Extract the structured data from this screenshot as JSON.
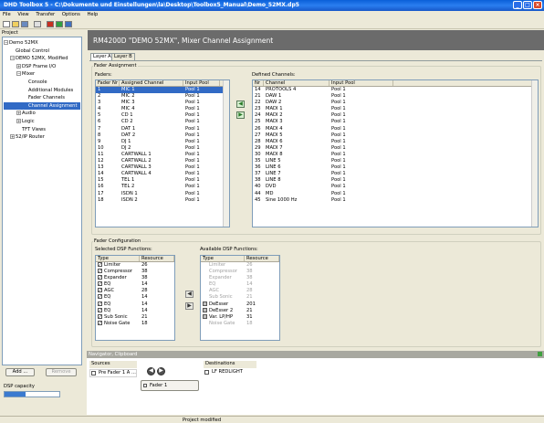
{
  "window": {
    "title": "DHD Toolbox 5 - C:\\Dokumente und Einstellungen\\la\\Desktop\\Toolbox5_Manual\\Demo_52MX.dp5"
  },
  "menu": [
    "File",
    "View",
    "Transfer",
    "Options",
    "Help"
  ],
  "project": {
    "label": "Project",
    "tree": [
      {
        "label": "Demo 52MX",
        "level": 0,
        "exp": "−"
      },
      {
        "label": "Global Control",
        "level": 1,
        "exp": ""
      },
      {
        "label": "DEMO 52MX, Modified",
        "level": 1,
        "exp": "−"
      },
      {
        "label": "DSP Frame I/O",
        "level": 2,
        "exp": "+"
      },
      {
        "label": "Mixer",
        "level": 2,
        "exp": "−"
      },
      {
        "label": "Console",
        "level": 3,
        "exp": ""
      },
      {
        "label": "Additional Modules",
        "level": 3,
        "exp": ""
      },
      {
        "label": "Fader Channels",
        "level": 3,
        "exp": ""
      },
      {
        "label": "Channel Assignment",
        "level": 3,
        "exp": "",
        "selected": true
      },
      {
        "label": "Audio",
        "level": 2,
        "exp": "+"
      },
      {
        "label": "Logic",
        "level": 2,
        "exp": "+"
      },
      {
        "label": "TFT Views",
        "level": 2,
        "exp": ""
      },
      {
        "label": "52/IP Router",
        "level": 1,
        "exp": "+"
      }
    ],
    "add_label": "Add ...",
    "remove_label": "Remove",
    "dsp_capacity_label": "DSP capacity",
    "dsp_capacity_percent": 38
  },
  "header": {
    "title": "RM4200D \"DEMO 52MX\", Mixer Channel Assignment"
  },
  "tabs": [
    "Layer A",
    "Layer B"
  ],
  "fader_assignment": {
    "label": "Fader Assignment",
    "faders_label": "Faders:",
    "defined_label": "Defined Channels:",
    "fader_headers": [
      "Fader Nr",
      "Assigned Channel",
      "Input Pool"
    ],
    "faders": [
      [
        "1",
        "MIC 1",
        "Pool 1"
      ],
      [
        "2",
        "MIC 2",
        "Pool 1"
      ],
      [
        "3",
        "MIC 3",
        "Pool 1"
      ],
      [
        "4",
        "MIC 4",
        "Pool 1"
      ],
      [
        "5",
        "CD 1",
        "Pool 1"
      ],
      [
        "6",
        "CD 2",
        "Pool 1"
      ],
      [
        "7",
        "DAT 1",
        "Pool 1"
      ],
      [
        "8",
        "DAT 2",
        "Pool 1"
      ],
      [
        "9",
        "DJ 1",
        "Pool 1"
      ],
      [
        "10",
        "DJ 2",
        "Pool 1"
      ],
      [
        "11",
        "CARTWALL 1",
        "Pool 1"
      ],
      [
        "12",
        "CARTWALL 2",
        "Pool 1"
      ],
      [
        "13",
        "CARTWALL 3",
        "Pool 1"
      ],
      [
        "14",
        "CARTWALL 4",
        "Pool 1"
      ],
      [
        "15",
        "TEL 1",
        "Pool 1"
      ],
      [
        "16",
        "TEL 2",
        "Pool 1"
      ],
      [
        "17",
        "ISDN 1",
        "Pool 1"
      ],
      [
        "18",
        "ISDN 2",
        "Pool 1"
      ]
    ],
    "defined_headers": [
      "Nr",
      "Channel",
      "Input Pool"
    ],
    "defined": [
      [
        "14",
        "PROTOOLS 4",
        "Pool 1"
      ],
      [
        "21",
        "DAW 1",
        "Pool 1"
      ],
      [
        "22",
        "DAW 2",
        "Pool 1"
      ],
      [
        "23",
        "MADI 1",
        "Pool 1"
      ],
      [
        "24",
        "MADI 2",
        "Pool 1"
      ],
      [
        "25",
        "MADI 3",
        "Pool 1"
      ],
      [
        "26",
        "MADI 4",
        "Pool 1"
      ],
      [
        "27",
        "MADI 5",
        "Pool 1"
      ],
      [
        "28",
        "MADI 6",
        "Pool 1"
      ],
      [
        "29",
        "MADI 7",
        "Pool 1"
      ],
      [
        "30",
        "MADI 8",
        "Pool 1"
      ],
      [
        "35",
        "LINE 5",
        "Pool 1"
      ],
      [
        "36",
        "LINE 6",
        "Pool 1"
      ],
      [
        "37",
        "LINE 7",
        "Pool 1"
      ],
      [
        "38",
        "LINE 8",
        "Pool 1"
      ],
      [
        "40",
        "DVD",
        "Pool 1"
      ],
      [
        "44",
        "MD",
        "Pool 1"
      ],
      [
        "45",
        "Sine 1000 Hz",
        "Pool 1"
      ]
    ]
  },
  "fader_config": {
    "label": "Fader Configuration",
    "selected_label": "Selected DSP Functions:",
    "available_label": "Available DSP Functions:",
    "headers": [
      "Type",
      "Resource"
    ],
    "selected": [
      [
        "Limiter",
        "26",
        "check"
      ],
      [
        "Compressor",
        "38",
        "check"
      ],
      [
        "Expander",
        "38",
        "check"
      ],
      [
        "EQ",
        "14",
        "check"
      ],
      [
        "AGC",
        "28",
        "check"
      ],
      [
        "EQ",
        "14",
        "check"
      ],
      [
        "EQ",
        "14",
        "check"
      ],
      [
        "EQ",
        "14",
        "check"
      ],
      [
        "Sub Sonic",
        "21",
        "check"
      ],
      [
        "Noise Gate",
        "18",
        "check"
      ]
    ],
    "available": [
      [
        "Limiter",
        "26",
        "none"
      ],
      [
        "Compressor",
        "38",
        "none"
      ],
      [
        "Expander",
        "38",
        "none"
      ],
      [
        "EQ",
        "14",
        "none"
      ],
      [
        "AGC",
        "28",
        "none"
      ],
      [
        "Sub Sonic",
        "21",
        "none"
      ],
      [
        "DeEsser",
        "201",
        "box"
      ],
      [
        "DeEsser 2",
        "21",
        "box"
      ],
      [
        "Var. LP/HP",
        "31",
        "box"
      ],
      [
        "Noise Gate",
        "18",
        "none"
      ]
    ]
  },
  "navigator": {
    "label": "Navigator, Clipboard",
    "sources_label": "Sources",
    "source_item": "Pre Fader 1 A ...",
    "fader_button": "Fader 1",
    "destinations_label": "Destinations",
    "destination_item": "LF REDLIGHT"
  },
  "status": {
    "text": "Project modified"
  }
}
